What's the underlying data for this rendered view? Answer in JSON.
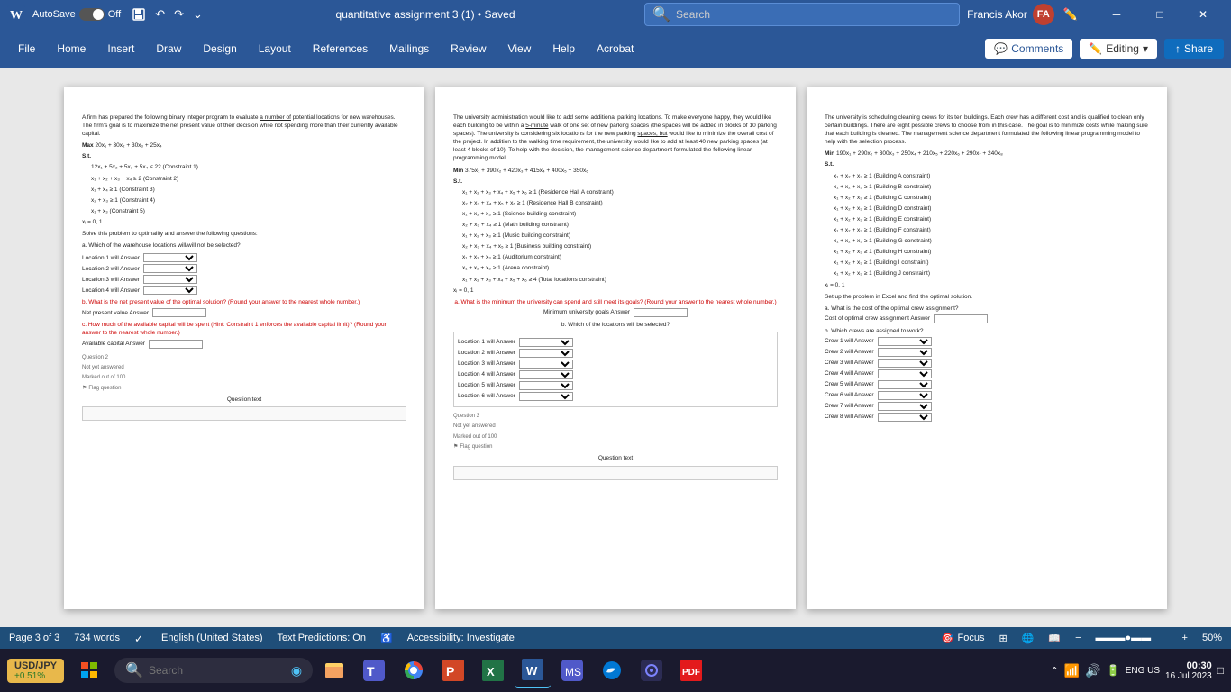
{
  "titlebar": {
    "autosave_label": "AutoSave",
    "autosave_state": "Off",
    "doc_title": "quantitative assignment 3 (1) • Saved",
    "search_placeholder": "Search",
    "user_name": "Francis Akor",
    "user_initials": "FA"
  },
  "ribbon": {
    "tabs": [
      "File",
      "Home",
      "Insert",
      "Draw",
      "Design",
      "Layout",
      "References",
      "Mailings",
      "Review",
      "View",
      "Help",
      "Acrobat"
    ],
    "comments_label": "Comments",
    "editing_label": "Editing",
    "share_label": "Share"
  },
  "pages": {
    "page1": {
      "intro": "A firm has prepared the following binary integer program to evaluate a number of potential locations for new warehouses. The firm's goal is to maximize the net present value of their decision while not spending more than their currently available capital.",
      "objective": "Max 20x₁ + 30x₂ + 30x₃ + 25x₄",
      "st_label": "S.t.",
      "constraints": [
        "12x₁ + 5x₂ + 5x₃ + 5x₄ ≤ 22 (Constraint 1)",
        "x₁ + x₂ + x₃ + x₄ ≥ 2 (Constraint 2)",
        "x₁ + x₄ ≥ 1 (Constraint 3)",
        "x₂ + x₃ ≥ 1 (Constraint 4)",
        "x₁ + x₃ (Constraint 5)"
      ],
      "binary": "xᵢ = 0, 1",
      "instruction": "Solve this problem to optimality and answer the following questions:",
      "qa_label": "a.  Which of the warehouse locations will/will not be selected?",
      "locations": [
        "Location 1 will Answer",
        "Location 2 will Answer",
        "Location 3 will Answer",
        "Location 4 will Answer"
      ],
      "qb_label": "b.  What is the net present value of the optimal solution? (Round your answer to the nearest whole number.)",
      "npv_label": "Net present value Answer",
      "qc_label": "c.  How much of the available capital will be spent (Hint: Constraint 1 enforces the available capital limit)? (Round your answer to the nearest whole number.)",
      "capital_label": "Available capital Answer",
      "question_num": "Question 2",
      "not_yet": "Not yet answered",
      "marked": "Marked out of 100",
      "flag": "Flag question",
      "question_text": "Question text"
    },
    "page2": {
      "intro": "The university administration would like to add some additional parking locations. To make everyone happy, they would like each building to be within a 5-minute walk of one set of new parking spaces (the spaces will be added in blocks of 10 parking spaces). The university is considering six locations for the new parking spaces, but would like to minimize the overall cost of the project. In addition to the walking time requirement, the university would like to add at least 40 new parking spaces (at least 4 blocks of 10). To help with the decision, the management science department formulated the following linear programming model:",
      "objective": "Min 375x₁ + 390x₂ + 420x₃ + 415x₄ + 400x₅ + 350x₆",
      "st_label": "S.t.",
      "constraints": [
        "x₁ + x₂ + x₃ + x₄ + x₅ + x₆ ≥ 1 (Residence Hall A constraint)",
        "x₂ + x₃ + x₄ + x₅ + x₆ ≥ 1 (Residence Hall B constraint)",
        "x₁ + x₂ + x₃ ≥ 1 (Science building constraint)",
        "x₁ + x₂ + x₃ ≥ 1 (Math building constraint)",
        "x₂ + x₃ + x₄ + x₅ ≥ 1 (Music building constraint)",
        "x₂ + x₃ + x₄ + x₅ ≥ 1 (Business building constraint)",
        "x₁ + x₂ + x₃ ≥ 1 (Auditorium constraint)",
        "x₁ + x₂ + x₃ ≥ 1 (Arena constraint)",
        "x₁ + x₂ + x₃ + x₄ + x₅ + x₆ ≥ 4 (Total locations constraint)"
      ],
      "binary": "xᵢ = 0, 1",
      "qa_label": "a.  What is the minimum the university can spend and still meet its goals? (Round your answer to the nearest whole number.)",
      "min_goals_label": "Minimum university goals Answer",
      "qb_label": "b.  Which of the locations will be selected?",
      "locations": [
        "Location 1 will Answer",
        "Location 2 will Answer",
        "Location 3 will Answer",
        "Location 4 will Answer",
        "Location 5 will Answer",
        "Location 6 will Answer"
      ],
      "question_num": "Question 3",
      "not_yet": "Not yet answered",
      "marked": "Marked out of 100",
      "flag": "Flag question",
      "question_text": "Question text"
    },
    "page3": {
      "intro": "The university is scheduling cleaning crews for its ten buildings. Each crew has a different cost and is qualified to clean only certain buildings. There are eight possible crews to choose from in this case. The goal is to minimize costs while making sure that each building is cleaned. The management science department formulated the following linear programming model to help with the selection process.",
      "objective": "Min 190x₁ + 290x₂ + 300x₃ + 250x₄ + 210x₅ + 220x₆ + 290x₇ + 240x₈",
      "st_label": "S.t.",
      "constraints": [
        "x₁ + x₂ + x₃ ≥ 1 (Building A constraint)",
        "x₁ + x₂ + x₃ ≥ 1 (Building B constraint)",
        "x₁ + x₂ + x₃ ≥ 1 (Building C constraint)",
        "x₁ + x₂ + x₃ ≥ 1 (Building D constraint)",
        "x₁ + x₂ + x₃ ≥ 1 (Building E constraint)",
        "x₁ + x₂ + x₃ ≥ 1 (Building F constraint)",
        "x₁ + x₂ + x₃ ≥ 1 (Building G constraint)",
        "x₁ + x₂ + x₃ ≥ 1 (Building H constraint)",
        "x₁ + x₂ + x₃ ≥ 1 (Building I constraint)",
        "x₁ + x₂ + x₃ ≥ 1 (Building J constraint)"
      ],
      "binary": "xᵢ = 0, 1",
      "excel_label": "Set up the problem in Excel and find the optimal solution.",
      "qa_label": "a. What is the cost of the optimal crew assignment?",
      "cost_label": "Cost of optimal crew assignment Answer",
      "qb_label": "b. Which crews are assigned to work?",
      "crews": [
        "Crew 1 will Answer",
        "Crew 2 will Answer",
        "Crew 3 will Answer",
        "Crew 4 will Answer",
        "Crew 5 will Answer",
        "Crew 6 will Answer",
        "Crew 7 will Answer",
        "Crew 8 will Answer"
      ]
    }
  },
  "statusbar": {
    "page_info": "Page 3 of 3",
    "word_count": "734 words",
    "language": "English (United States)",
    "text_predictions": "Text Predictions: On",
    "accessibility": "Accessibility: Investigate",
    "focus_label": "Focus",
    "zoom_level": "50%"
  },
  "taskbar": {
    "search_placeholder": "Search",
    "currency": "USD/JPY",
    "currency_change": "+0.51%",
    "time": "00:30",
    "date": "16 Jul 2023",
    "language": "ENG US"
  }
}
